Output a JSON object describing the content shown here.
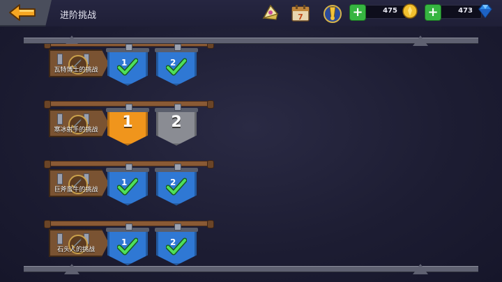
{
  "header": {
    "title": "进阶挑战",
    "calendar_day": "7",
    "resource_gold": "475",
    "resource_gem": "473"
  },
  "colors": {
    "completed_banner": "#2f78d4",
    "current_banner": "#f0951c",
    "locked_banner": "#8a8c93",
    "check": "#3dd44a",
    "wood": "#7a5332"
  },
  "rows": [
    {
      "label": "瓦特博士的挑战",
      "stages": [
        {
          "state": "completed",
          "index": "1"
        },
        {
          "state": "completed",
          "index": "2"
        }
      ]
    },
    {
      "label": "寒冰射手的挑战",
      "stages": [
        {
          "state": "current",
          "index": "1"
        },
        {
          "state": "locked",
          "index": "2"
        }
      ]
    },
    {
      "label": "巨斧蛮牛的挑战",
      "stages": [
        {
          "state": "completed",
          "index": "1"
        },
        {
          "state": "completed",
          "index": "2"
        }
      ]
    },
    {
      "label": "石头人的挑战",
      "stages": [
        {
          "state": "completed",
          "index": "1"
        },
        {
          "state": "completed",
          "index": "2"
        }
      ]
    }
  ]
}
